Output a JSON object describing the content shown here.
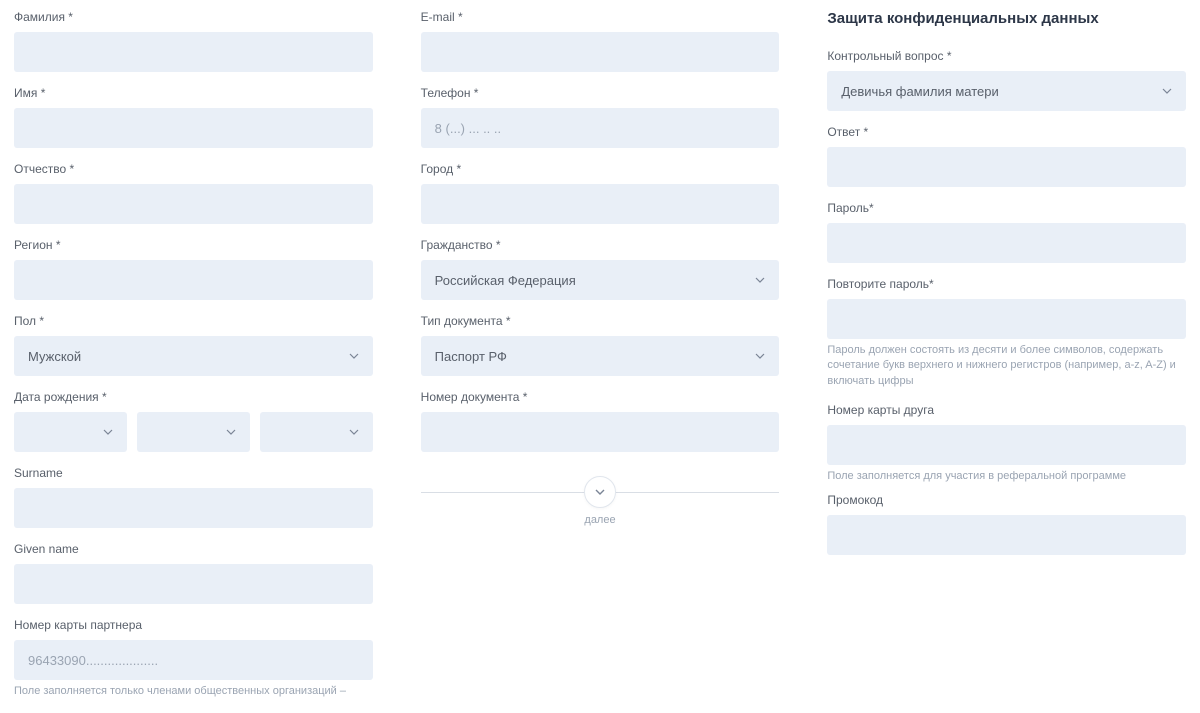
{
  "col1": {
    "surname_label": "Фамилия *",
    "name_label": "Имя *",
    "patronymic_label": "Отчество *",
    "region_label": "Регион *",
    "gender_label": "Пол *",
    "gender_value": "Мужской",
    "dob_label": "Дата рождения *",
    "surname_en_label": "Surname",
    "given_name_label": "Given name",
    "partner_card_label": "Номер карты партнера",
    "partner_card_placeholder": "96433090....................",
    "partner_card_hint": "Поле заполняется только членами общественных организаций –"
  },
  "col2": {
    "email_label": "E-mail *",
    "phone_label": "Телефон *",
    "phone_placeholder": "8 (...) ... .. ..",
    "city_label": "Город *",
    "citizenship_label": "Гражданство *",
    "citizenship_value": "Российская Федерация",
    "doc_type_label": "Тип документа *",
    "doc_type_value": "Паспорт РФ",
    "doc_number_label": "Номер документа *",
    "more_label": "далее"
  },
  "col3": {
    "section_title": "Защита конфиденциальных данных",
    "question_label": "Контрольный вопрос *",
    "question_value": "Девичья фамилия матери",
    "answer_label": "Ответ *",
    "password_label": "Пароль*",
    "password2_label": "Повторите пароль*",
    "password_hint": "Пароль должен состоять из десяти и более символов, содержать сочетание букв верхнего и нижнего регистров (например, a-z, A-Z) и включать цифры",
    "friend_card_label": "Номер карты друга",
    "friend_card_hint": "Поле заполняется для участия в реферальной программе",
    "promo_label": "Промокод"
  }
}
